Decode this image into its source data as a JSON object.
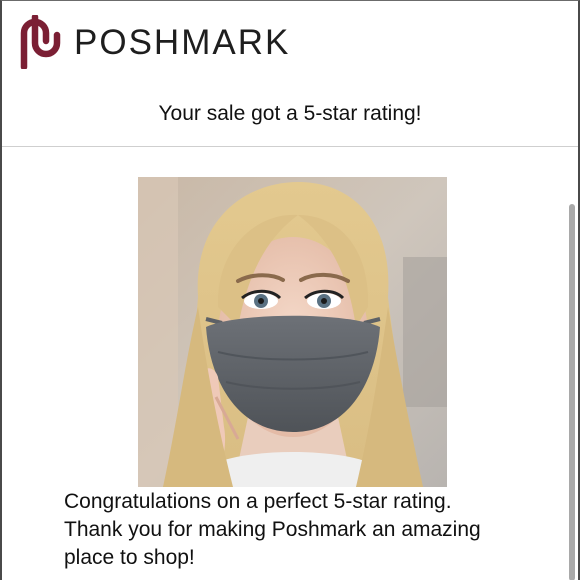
{
  "brand": {
    "name": "POSHMARK",
    "logo_icon": "poshmark-logo-icon",
    "logo_color": "#7b1f34"
  },
  "email": {
    "headline": "Your sale got a 5-star rating!",
    "photo": "product-photo-face-mask",
    "message_lines": [
      "Congratulations on a perfect 5-star rating.",
      "Thank you for making Poshmark an amazing",
      "place to shop!"
    ]
  },
  "colors": {
    "text": "#111111",
    "divider": "#cfcfcf",
    "scrollbar": "#a9a9a9"
  }
}
